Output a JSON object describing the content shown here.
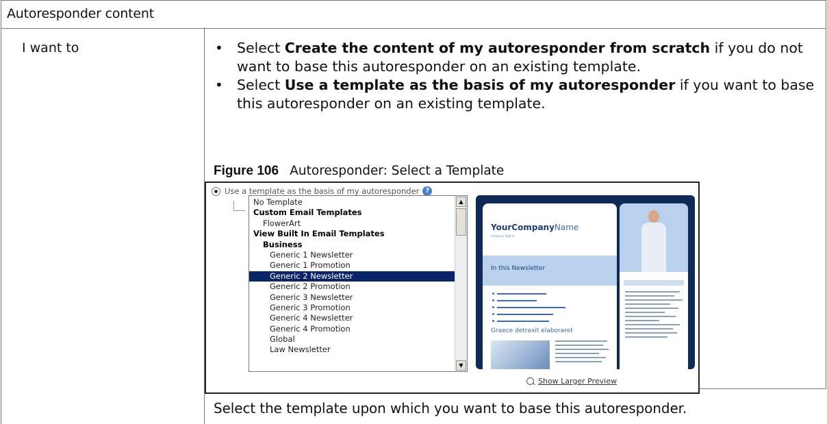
{
  "section_header": "Autoresponder content",
  "row_label": "I want to",
  "bullets": [
    {
      "bold": "Create the content of my autoresponder from scratch",
      "prefix": "Select ",
      "suffix": " if you do not want to base this autoresponder on an existing template."
    },
    {
      "bold": "Use a template as the basis of my autoresponder",
      "prefix": "Select ",
      "suffix": " if you want to base this autoresponder on an existing template."
    }
  ],
  "figure": {
    "number": "Figure 106",
    "title": "Autoresponder: Select a Template",
    "radio_label": "Use a template as the basis of my autoresponder",
    "list_items": [
      {
        "label": "No Template",
        "kind": "item",
        "indent": 0
      },
      {
        "label": "Custom Email Templates",
        "kind": "group",
        "indent": 0
      },
      {
        "label": "FlowerArt",
        "kind": "item",
        "indent": 1
      },
      {
        "label": "View Built In Email Templates",
        "kind": "group",
        "indent": 0
      },
      {
        "label": "Business",
        "kind": "group",
        "indent": 1
      },
      {
        "label": "Generic 1 Newsletter",
        "kind": "item",
        "indent": 2
      },
      {
        "label": "Generic 1 Promotion",
        "kind": "item",
        "indent": 2
      },
      {
        "label": "Generic 2 Newsletter",
        "kind": "item",
        "indent": 2,
        "selected": true
      },
      {
        "label": "Generic 2 Promotion",
        "kind": "item",
        "indent": 2
      },
      {
        "label": "Generic 3 Newsletter",
        "kind": "item",
        "indent": 2
      },
      {
        "label": "Generic 3 Promotion",
        "kind": "item",
        "indent": 2
      },
      {
        "label": "Generic 4 Newsletter",
        "kind": "item",
        "indent": 2
      },
      {
        "label": "Generic 4 Promotion",
        "kind": "item",
        "indent": 2
      },
      {
        "label": "Global",
        "kind": "item",
        "indent": 2
      },
      {
        "label": "Law Newsletter",
        "kind": "item",
        "indent": 2
      }
    ],
    "preview": {
      "company_bold": "YourCompany",
      "company_rest": "Name",
      "tagline": "Company Tagline",
      "band_title": "In this Newsletter",
      "section_title": "Graece detraxit elaboraret"
    },
    "larger_preview_link": "Show Larger Preview"
  },
  "footer_text": "Select the template upon which you want to base this autoresponder."
}
